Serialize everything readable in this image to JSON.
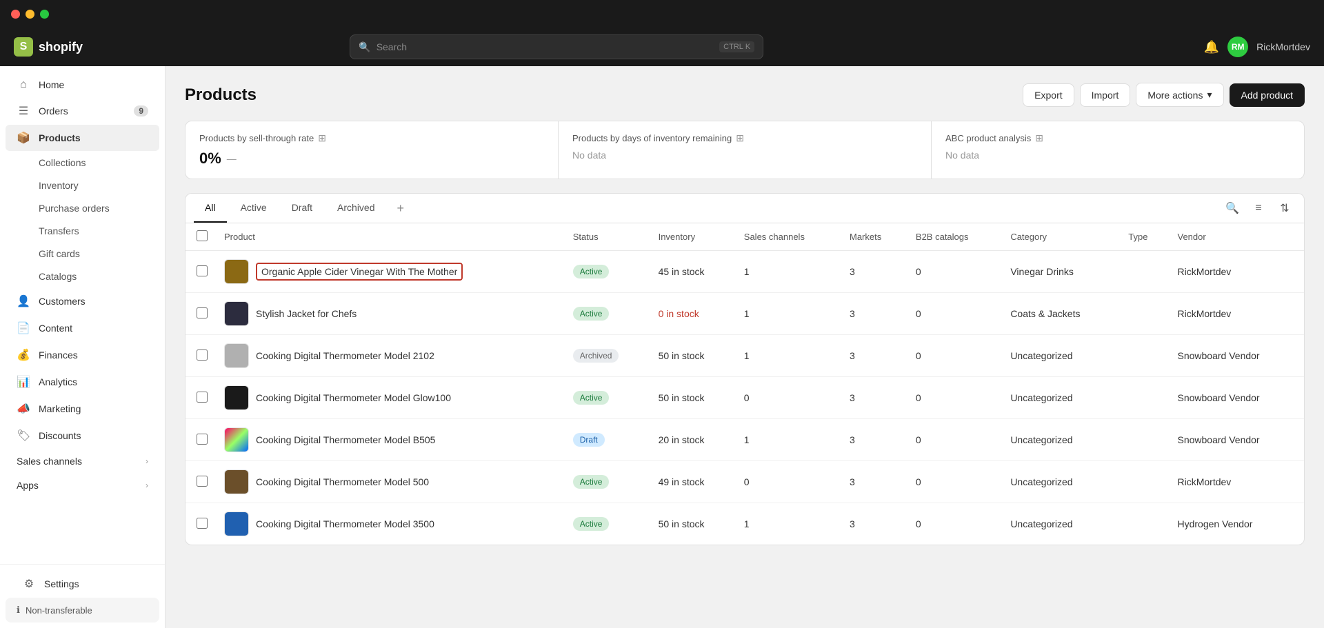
{
  "titlebar": {
    "dots": [
      "red",
      "yellow",
      "green"
    ]
  },
  "topnav": {
    "logo_text": "shopify",
    "search_placeholder": "Search",
    "search_shortcut_1": "CTRL",
    "search_shortcut_2": "K",
    "username": "RickMortdev"
  },
  "sidebar": {
    "nav_items": [
      {
        "id": "home",
        "label": "Home",
        "icon": "⌂",
        "badge": null,
        "active": false
      },
      {
        "id": "orders",
        "label": "Orders",
        "icon": "📋",
        "badge": "9",
        "active": false
      },
      {
        "id": "products",
        "label": "Products",
        "icon": "📦",
        "badge": null,
        "active": true
      }
    ],
    "sub_nav_items": [
      {
        "id": "collections",
        "label": "Collections"
      },
      {
        "id": "inventory",
        "label": "Inventory"
      },
      {
        "id": "purchase-orders",
        "label": "Purchase orders"
      },
      {
        "id": "transfers",
        "label": "Transfers"
      },
      {
        "id": "gift-cards",
        "label": "Gift cards"
      },
      {
        "id": "catalogs",
        "label": "Catalogs"
      }
    ],
    "nav_items_2": [
      {
        "id": "customers",
        "label": "Customers",
        "icon": "👤",
        "active": false
      },
      {
        "id": "content",
        "label": "Content",
        "icon": "📄",
        "active": false
      },
      {
        "id": "finances",
        "label": "Finances",
        "icon": "💰",
        "active": false
      },
      {
        "id": "analytics",
        "label": "Analytics",
        "icon": "📊",
        "active": false
      },
      {
        "id": "marketing",
        "label": "Marketing",
        "icon": "📣",
        "active": false
      },
      {
        "id": "discounts",
        "label": "Discounts",
        "icon": "🏷️",
        "active": false
      }
    ],
    "sales_channels_label": "Sales channels",
    "apps_label": "Apps",
    "settings_label": "Settings",
    "settings_icon": "⚙",
    "non_transferable_label": "Non-transferable",
    "non_transferable_icon": "ℹ"
  },
  "page": {
    "title": "Products",
    "export_label": "Export",
    "import_label": "Import",
    "more_actions_label": "More actions",
    "add_product_label": "Add product"
  },
  "stats": [
    {
      "title": "Products by sell-through rate",
      "value": "0%",
      "sub": "—"
    },
    {
      "title": "Products by days of inventory remaining",
      "value": null,
      "no_data": "No data"
    },
    {
      "title": "ABC product analysis",
      "value": null,
      "no_data": "No data"
    }
  ],
  "tabs": [
    {
      "id": "all",
      "label": "All",
      "active": true
    },
    {
      "id": "active",
      "label": "Active",
      "active": false
    },
    {
      "id": "draft",
      "label": "Draft",
      "active": false
    },
    {
      "id": "archived",
      "label": "Archived",
      "active": false
    }
  ],
  "table": {
    "columns": [
      "Product",
      "Status",
      "Inventory",
      "Sales channels",
      "Markets",
      "B2B catalogs",
      "Category",
      "Type",
      "Vendor"
    ],
    "rows": [
      {
        "name": "Organic Apple Cider Vinegar With The Mother",
        "highlight": true,
        "thumb_color": "brown",
        "status": "Active",
        "status_class": "status-active",
        "inventory": "45 in stock",
        "inventory_class": "inventory-normal",
        "sales_channels": "1",
        "markets": "3",
        "b2b": "0",
        "category": "Vinegar Drinks",
        "type": "",
        "vendor": "RickMortdev"
      },
      {
        "name": "Stylish Jacket for Chefs",
        "highlight": false,
        "thumb_color": "dark",
        "status": "Active",
        "status_class": "status-active",
        "inventory": "0 in stock",
        "inventory_class": "inventory-red",
        "sales_channels": "1",
        "markets": "3",
        "b2b": "0",
        "category": "Coats & Jackets",
        "type": "",
        "vendor": "RickMortdev"
      },
      {
        "name": "Cooking Digital Thermometer Model 2102",
        "highlight": false,
        "thumb_color": "gray",
        "status": "Archived",
        "status_class": "status-archived",
        "inventory": "50 in stock",
        "inventory_class": "inventory-normal",
        "sales_channels": "1",
        "markets": "3",
        "b2b": "0",
        "category": "Uncategorized",
        "type": "",
        "vendor": "Snowboard Vendor"
      },
      {
        "name": "Cooking Digital Thermometer Model Glow100",
        "highlight": false,
        "thumb_color": "black",
        "status": "Active",
        "status_class": "status-active",
        "inventory": "50 in stock",
        "inventory_class": "inventory-normal",
        "sales_channels": "0",
        "markets": "3",
        "b2b": "0",
        "category": "Uncategorized",
        "type": "",
        "vendor": "Snowboard Vendor"
      },
      {
        "name": "Cooking Digital Thermometer Model B505",
        "highlight": false,
        "thumb_color": "colorful",
        "status": "Draft",
        "status_class": "status-draft",
        "inventory": "20 in stock",
        "inventory_class": "inventory-normal",
        "sales_channels": "1",
        "markets": "3",
        "b2b": "0",
        "category": "Uncategorized",
        "type": "",
        "vendor": "Snowboard Vendor"
      },
      {
        "name": "Cooking Digital Thermometer Model 500",
        "highlight": false,
        "thumb_color": "brown2",
        "status": "Active",
        "status_class": "status-active",
        "inventory": "49 in stock",
        "inventory_class": "inventory-normal",
        "sales_channels": "0",
        "markets": "3",
        "b2b": "0",
        "category": "Uncategorized",
        "type": "",
        "vendor": "RickMortdev"
      },
      {
        "name": "Cooking Digital Thermometer Model 3500",
        "highlight": false,
        "thumb_color": "blue",
        "status": "Active",
        "status_class": "status-active",
        "inventory": "50 in stock",
        "inventory_class": "inventory-normal",
        "sales_channels": "1",
        "markets": "3",
        "b2b": "0",
        "category": "Uncategorized",
        "type": "",
        "vendor": "Hydrogen Vendor"
      }
    ]
  }
}
